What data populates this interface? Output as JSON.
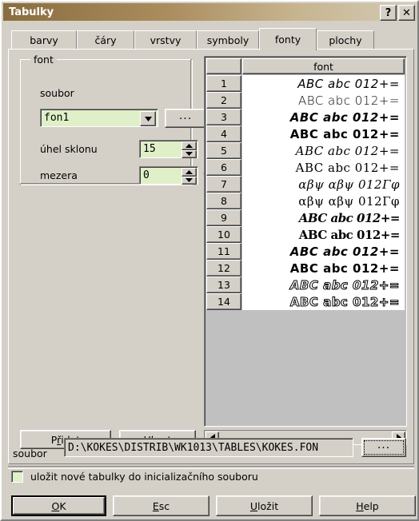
{
  "window": {
    "title": "Tabulky",
    "help_button": "?",
    "close_button": "✕"
  },
  "tabs": [
    {
      "label": "barvy",
      "active": false
    },
    {
      "label": "čáry",
      "active": false
    },
    {
      "label": "vrstvy",
      "active": false
    },
    {
      "label": "symboly",
      "active": false
    },
    {
      "label": "fonty",
      "active": true
    },
    {
      "label": "plochy",
      "active": false
    }
  ],
  "font_group": {
    "title": "font",
    "soubor_label": "soubor",
    "soubor_value": "fon1",
    "dropdown_icon": "chevron-down-icon",
    "browse_label": "...",
    "angle_label": "úhel sklonu",
    "angle_value": "15",
    "angle_unit": "°",
    "spacing_label": "mezera",
    "spacing_value": "0",
    "spacing_unit": "%"
  },
  "grid": {
    "corner_label": "",
    "column_header": "font",
    "rows": [
      {
        "num": "1",
        "sample": "ABC  abc  012+=",
        "style": "s-sans-i"
      },
      {
        "num": "2",
        "sample": "ABC  abc  012+=",
        "style": "s-sans"
      },
      {
        "num": "3",
        "sample": "ABC  abc  012+=",
        "style": "s-sans-bi"
      },
      {
        "num": "4",
        "sample": "ABC  abc  012+=",
        "style": "s-sans-b"
      },
      {
        "num": "5",
        "sample": "ABC  abc  012+=",
        "style": "s-serif-i"
      },
      {
        "num": "6",
        "sample": "ABC  abc  012+=",
        "style": "s-serif"
      },
      {
        "num": "7",
        "sample": "αβψ  αβψ  012Γφ",
        "style": "s-greek-i"
      },
      {
        "num": "8",
        "sample": "αβψ  αβψ  012Γφ",
        "style": "s-greek"
      },
      {
        "num": "9",
        "sample": "ABC  abc  012+=",
        "style": "s-goth-i"
      },
      {
        "num": "10",
        "sample": "ABC  abc  012+=",
        "style": "s-goth"
      },
      {
        "num": "11",
        "sample": "ABC abc 012+=",
        "style": "s-sans-bi"
      },
      {
        "num": "12",
        "sample": "ABC abc 012+=",
        "style": "s-sans-b"
      },
      {
        "num": "13",
        "sample": "ABC abc 012+=",
        "style": "s-out-i"
      },
      {
        "num": "14",
        "sample": "ABC abc 012+=",
        "style": "s-out"
      }
    ]
  },
  "hscrollbar": {
    "left_arrow": "◄",
    "right_arrow": "►"
  },
  "panel_buttons": {
    "add": {
      "pre": "P",
      "accel": "ř",
      "post": "idat"
    },
    "remove": {
      "pre": "Ubra",
      "accel": "t",
      "post": ""
    }
  },
  "file_row": {
    "label": "soubor",
    "path": "D:\\KOKES\\DISTRIB\\WK1013\\TABLES\\KOKES.FON",
    "browse_label": "..."
  },
  "checkbox": {
    "checked": false,
    "label": "uložit nové tabulky do inicializačního souboru"
  },
  "footer_buttons": [
    {
      "pre": "",
      "accel": "O",
      "post": "K",
      "default": true
    },
    {
      "pre": "",
      "accel": "E",
      "post": "sc",
      "default": false
    },
    {
      "pre": "",
      "accel": "U",
      "post": "ložit",
      "default": false
    },
    {
      "pre": "",
      "accel": "H",
      "post": "elp",
      "default": false
    }
  ],
  "colors": {
    "face": "#d4d0c8",
    "field_green": "#dff0c8",
    "title_left": "#8a6d3f",
    "title_right": "#d4cbb4",
    "grid_empty": "#c0c0c0"
  }
}
